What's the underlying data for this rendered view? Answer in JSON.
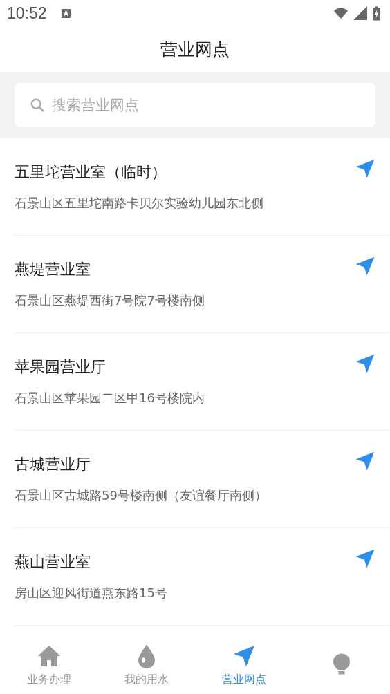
{
  "status_bar": {
    "time": "10:52"
  },
  "header": {
    "title": "营业网点"
  },
  "search": {
    "placeholder": "搜索营业网点"
  },
  "branches": [
    {
      "name": "五里坨营业室（临时）",
      "address": "石景山区五里坨南路卡贝尔实验幼儿园东北侧"
    },
    {
      "name": "燕堤营业室",
      "address": "石景山区燕堤西街7号院7号楼南侧"
    },
    {
      "name": "苹果园营业厅",
      "address": "石景山区苹果园二区甲16号楼院内"
    },
    {
      "name": "古城营业厅",
      "address": "石景山区古城路59号楼南侧（友谊餐厅南侧）"
    },
    {
      "name": "燕山营业室",
      "address": "房山区迎风街道燕东路15号"
    }
  ],
  "tabs": [
    {
      "label": "业务办理",
      "selected": false
    },
    {
      "label": "我的用水",
      "selected": false
    },
    {
      "label": "营业网点",
      "selected": true
    },
    {
      "selected": false
    }
  ]
}
